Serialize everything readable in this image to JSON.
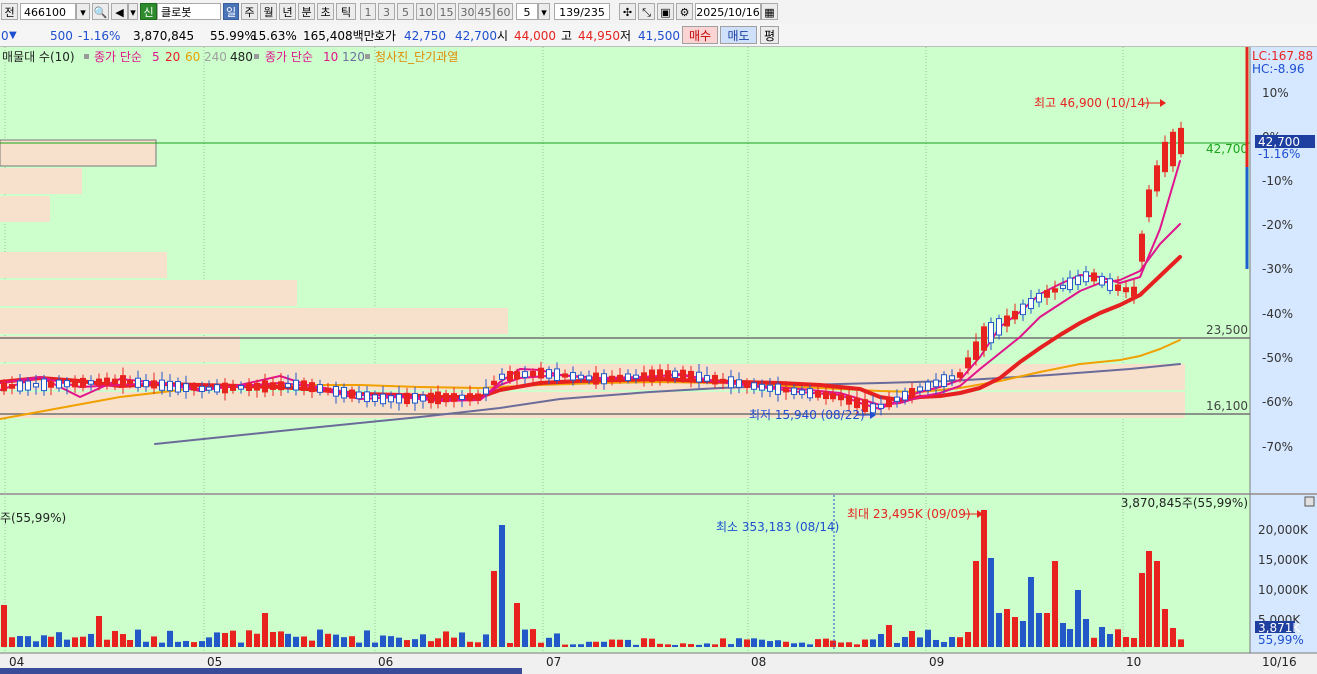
{
  "toolbar": {
    "market_label": "전",
    "code": "466100",
    "badge": "신",
    "name": "클로봇",
    "periods": [
      "일",
      "주",
      "월",
      "년",
      "분",
      "초",
      "틱"
    ],
    "active_period": "일",
    "intervals": [
      "1",
      "3",
      "5",
      "10",
      "15",
      "30",
      "45",
      "60"
    ],
    "unit_count": "5",
    "page_count": "139/235",
    "date": "2025/10/16"
  },
  "quote": {
    "prefix": "0",
    "change": "500",
    "change_pct": "-1.16%",
    "volume": "3,870,845",
    "volume_ratio": "55.99%",
    "turnover": "15.63%",
    "amount": "165,408백만",
    "ask_label": "호가",
    "ask": "42,750",
    "bid": "42,700",
    "open_label": "시",
    "open": "44,000",
    "high_label": "고",
    "high": "44,950",
    "low_label": "저",
    "low": "41,500",
    "buy_label": "매수",
    "sell_label": "매도",
    "avg_label": "평"
  },
  "colors": {
    "chart_bg": "#ccffcc",
    "axis_bg": "#d6e8ff",
    "up": "#e8231f",
    "down": "#2358c9",
    "ma5": "#e0148c",
    "ma20": "#e62020",
    "ma60": "#f0a000",
    "ma240": "#7070a0",
    "profile": "#f7e1cc"
  },
  "legend": {
    "vp_label": "매물대 수(10)",
    "ma_label_1": "종가 단순",
    "ma_periods_1": [
      "5",
      "20",
      "60",
      "240",
      "480"
    ],
    "ma_label_2": "종가 단순",
    "ma_periods_2": [
      "10",
      "120"
    ],
    "signal_label": "청사진_단기과열"
  },
  "price_panel": {
    "lc_label": "LC:167.88",
    "hc_label": "HC:-8.96",
    "pct_ticks": [
      "10%",
      "0%",
      "-10%",
      "-20%",
      "-30%",
      "-40%",
      "-50%",
      "-60%",
      "-70%"
    ],
    "current_price": "42,700",
    "current_pct": "-1.16%",
    "hline_labels": [
      "42,700",
      "23,500",
      "16,100"
    ],
    "max_annotation": "최고 46,900 (10/14)",
    "min_annotation": "최저 15,940 (08/22)"
  },
  "volume_panel": {
    "top_right_label": "3,870,845주(55,99%)",
    "top_left_label": "주(55,99%)",
    "max_annotation": "최대 23,495K (09/09)",
    "min_annotation": "최소 353,183 (08/14)",
    "ticks": [
      "20,000K",
      "15,000K",
      "10,000K",
      "5,000K"
    ],
    "current_volume": "3,871K",
    "current_pct": "55,99%"
  },
  "x_axis": {
    "months": [
      "04",
      "05",
      "06",
      "07",
      "08",
      "09",
      "10"
    ],
    "end_date": "10/16"
  }
}
